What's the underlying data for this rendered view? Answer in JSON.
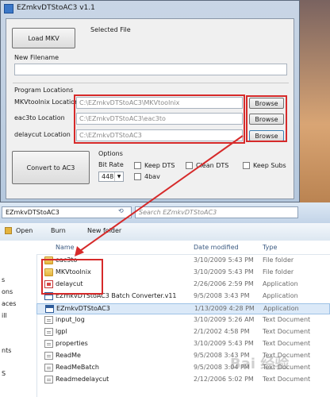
{
  "app_window": {
    "title": "EZmkvDTStoAC3 v1.1",
    "load_mkv_label": "Load MKV",
    "selected_file_label": "Selected File",
    "new_filename_label": "New Filename",
    "new_filename_value": "",
    "program_locations_label": "Program Locations",
    "locations": [
      {
        "label": "MKVtoolnix Location",
        "path": "C:\\EZmkvDTStoAC3\\MKVtoolnix",
        "browse": "Browse"
      },
      {
        "label": "eac3to Location",
        "path": "C:\\EZmkvDTStoAC3\\eac3to",
        "browse": "Browse"
      },
      {
        "label": "delaycut Location",
        "path": "C:\\EZmkvDTStoAC3",
        "browse": "Browse"
      }
    ],
    "convert_label": "Convert to AC3",
    "options_label": "Options",
    "bit_rate_label": "Bit Rate",
    "bit_rate_value": "448",
    "checkboxes": [
      "Keep DTS",
      "Clean DTS",
      "Keep Subs",
      "4bav"
    ]
  },
  "explorer": {
    "address_crumb": "EZmkvDTStoAC3",
    "search_placeholder": "Search EZmkvDTStoAC3",
    "toolbar": {
      "open": "Open",
      "burn": "Burn",
      "new_folder": "New folder"
    },
    "nav_items": [
      "s",
      "ons",
      "aces",
      "ill",
      "nts",
      "S"
    ],
    "columns": {
      "name": "Name",
      "date": "Date modified",
      "type": "Type"
    },
    "files": [
      {
        "name": "eac3to",
        "date": "3/10/2009 5:43 PM",
        "type": "File folder",
        "icon": "folder"
      },
      {
        "name": "MKVtoolnix",
        "date": "3/10/2009 5:43 PM",
        "type": "File folder",
        "icon": "folder"
      },
      {
        "name": "delaycut",
        "date": "2/26/2006 2:59 PM",
        "type": "Application",
        "icon": "exe"
      },
      {
        "name": "EZmkvDTStoAC3 Batch Converter.v11",
        "date": "9/5/2008 3:43 PM",
        "type": "Application",
        "icon": "app"
      },
      {
        "name": "EZmkvDTStoAC3",
        "date": "1/13/2009 4:28 PM",
        "type": "Application",
        "icon": "app"
      },
      {
        "name": "input_log",
        "date": "3/10/2009 5:26 AM",
        "type": "Text Document",
        "icon": "doc"
      },
      {
        "name": "lgpl",
        "date": "2/1/2002 4:58 PM",
        "type": "Text Document",
        "icon": "doc"
      },
      {
        "name": "properties",
        "date": "3/10/2009 5:43 PM",
        "type": "Text Document",
        "icon": "doc"
      },
      {
        "name": "ReadMe",
        "date": "9/5/2008 3:43 PM",
        "type": "Text Document",
        "icon": "doc"
      },
      {
        "name": "ReadMeBatch",
        "date": "9/5/2008 3:04 PM",
        "type": "Text Document",
        "icon": "doc"
      },
      {
        "name": "Readmedelaycut",
        "date": "2/12/2006 5:02 PM",
        "type": "Text Document",
        "icon": "doc"
      }
    ]
  },
  "colors": {
    "annotation_red": "#d62a2a",
    "selection": "#dbe9f8",
    "accent": "#3b5a82"
  }
}
